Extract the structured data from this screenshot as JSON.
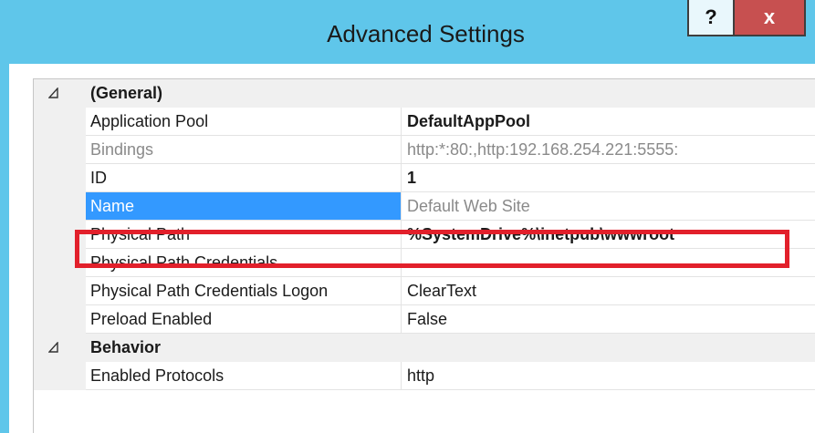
{
  "window": {
    "title": "Advanced Settings",
    "help_label": "?",
    "close_label": "x",
    "accent_color": "#5fc6ea",
    "close_color": "#c75050",
    "highlight_color": "#e2202b"
  },
  "categories": [
    {
      "label": "(General)",
      "icon": "collapse-triangle-icon"
    },
    {
      "label": "Behavior",
      "icon": "collapse-triangle-icon"
    }
  ],
  "properties": [
    {
      "name": "Application Pool",
      "value": "DefaultAppPool"
    },
    {
      "name": "Bindings",
      "value": "http:*:80:,http:192.168.254.221:5555:"
    },
    {
      "name": "ID",
      "value": "1"
    },
    {
      "name": "Name",
      "value": "Default Web Site"
    },
    {
      "name": "Physical Path",
      "value": "%SystemDrive%\\inetpub\\wwwroot"
    },
    {
      "name": "Physical Path Credentials",
      "value": ""
    },
    {
      "name": "Physical Path Credentials Logon",
      "value": "ClearText"
    },
    {
      "name": "Preload Enabled",
      "value": "False"
    },
    {
      "name": "Enabled Protocols",
      "value": "http"
    }
  ]
}
